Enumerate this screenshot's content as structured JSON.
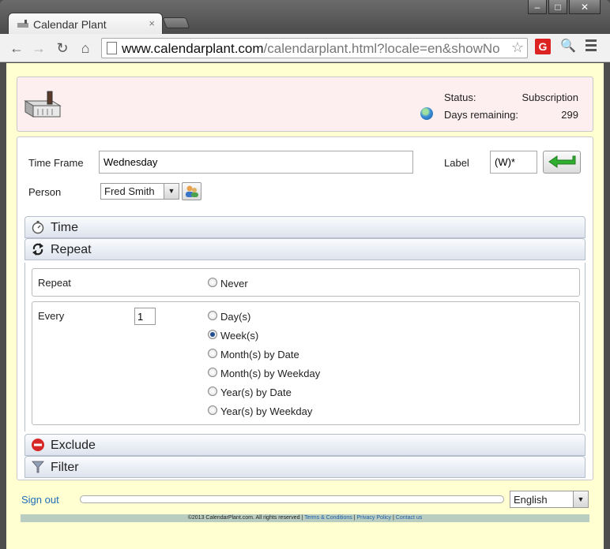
{
  "browser": {
    "tab_title": "Calendar Plant",
    "tab_close": "×",
    "url_host": "www.calendarplant.com",
    "url_path": "/calendarplant.html?locale=en&showNo",
    "window_min": "–",
    "window_max": "□",
    "window_close": "✕",
    "ext_g": "G"
  },
  "status": {
    "status_label": "Status:",
    "status_value": "Subscription",
    "days_label": "Days remaining:",
    "days_value": "299"
  },
  "form": {
    "time_frame_label": "Time Frame",
    "time_frame_value": "Wednesday",
    "label_label": "Label",
    "label_value": "(W)*",
    "person_label": "Person",
    "person_value": "Fred Smith"
  },
  "sections": {
    "time": "Time",
    "repeat": "Repeat",
    "exclude": "Exclude",
    "filter": "Filter"
  },
  "repeat": {
    "repeat_label": "Repeat",
    "never": "Never",
    "every_label": "Every",
    "every_value": "1",
    "options": [
      "Day(s)",
      "Week(s)",
      "Month(s) by Date",
      "Month(s) by Weekday",
      "Year(s) by Date",
      "Year(s) by Weekday"
    ],
    "selected": "Week(s)"
  },
  "bottom": {
    "sign_out": "Sign out",
    "language": "English"
  },
  "footer": {
    "copyright": "©2013 CalendarPlant.com. All rights reserved",
    "terms": "Terms & Conditions",
    "privacy": "Privacy Policy",
    "contact": "Contact us"
  },
  "colors": {
    "page_bg": "#ffffd2",
    "header_bg": "#fdeef0",
    "link": "#1f6fb8"
  }
}
